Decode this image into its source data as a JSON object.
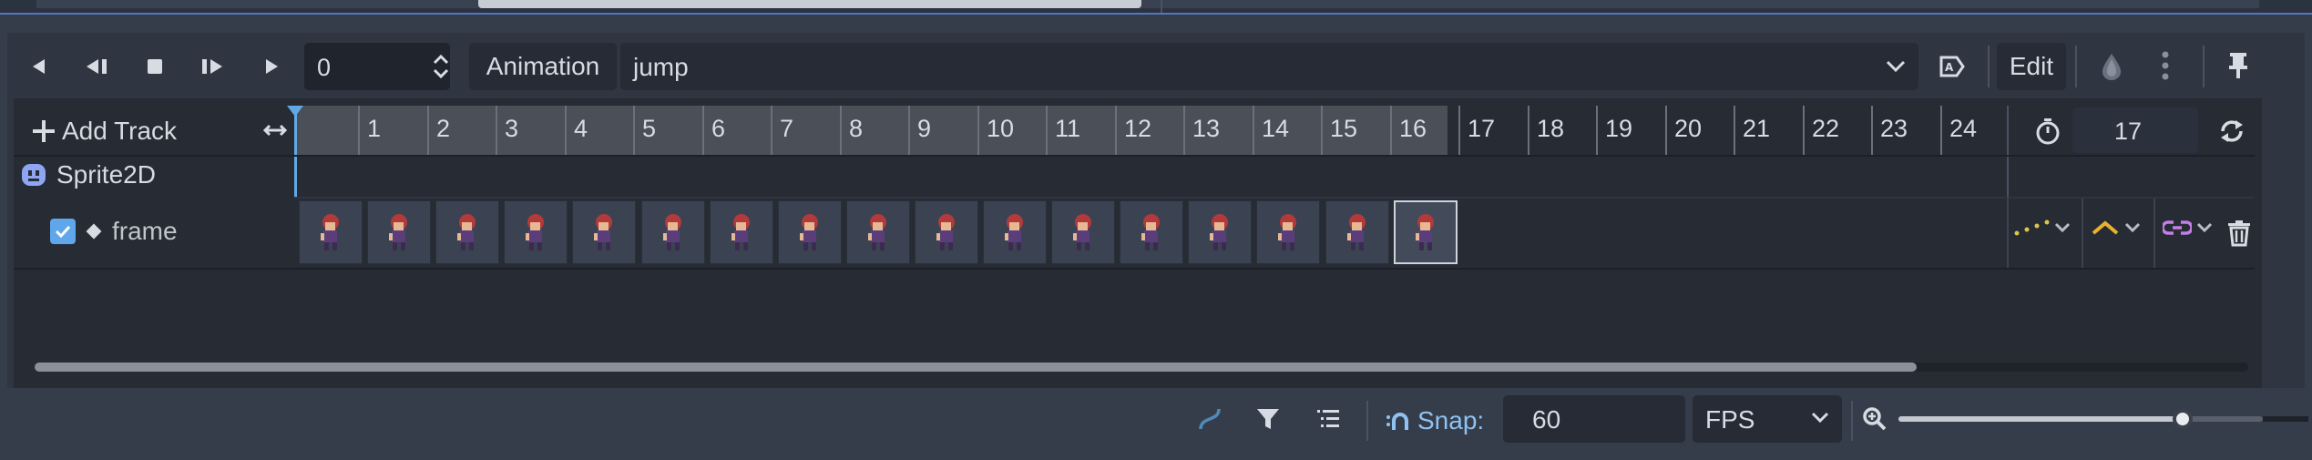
{
  "playback": {
    "frame_value": "0",
    "animation_button_label": "Animation",
    "selected_animation": "jump",
    "edit_label": "Edit"
  },
  "timeline": {
    "add_track_label": "Add Track",
    "ticks": [
      "1",
      "2",
      "3",
      "4",
      "5",
      "6",
      "7",
      "8",
      "9",
      "10",
      "11",
      "12",
      "13",
      "14",
      "15",
      "16",
      "17",
      "18",
      "19",
      "20",
      "21",
      "22",
      "23",
      "24"
    ],
    "played_frames": 16,
    "animation_length": "17"
  },
  "tracks": {
    "node_name": "Sprite2D",
    "property_name": "frame",
    "keyframe_count": 17,
    "selected_keyframe_index": 16
  },
  "bottom": {
    "snap_label": "Snap:",
    "snap_value": "60",
    "snap_unit": "FPS"
  },
  "zoom": {
    "level_fraction": 0.78
  },
  "scrollbar": {
    "visible_fraction": 0.85
  }
}
